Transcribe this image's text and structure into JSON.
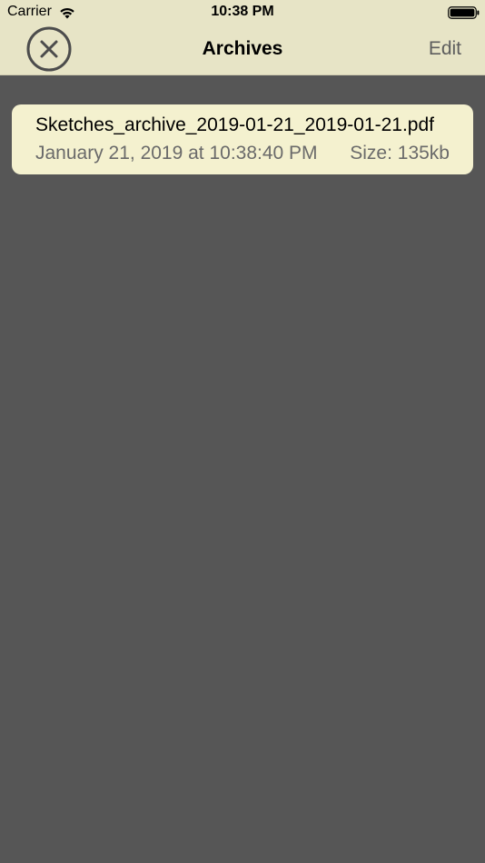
{
  "status_bar": {
    "carrier": "Carrier",
    "time": "10:38 PM",
    "wifi_icon": "wifi-icon",
    "battery_icon": "battery-icon"
  },
  "nav": {
    "title": "Archives",
    "edit_label": "Edit",
    "close_icon": "close-circle-icon"
  },
  "archives": [
    {
      "file_name": "Sketches_archive_2019-01-21_2019-01-21.pdf",
      "date": "January 21, 2019 at 10:38:40 PM",
      "size": "Size: 135kb"
    }
  ],
  "colors": {
    "header_bg": "#e7e4c6",
    "page_bg": "#565656",
    "card_bg": "#f4f1cf",
    "secondary_text": "#6a6a6a"
  }
}
